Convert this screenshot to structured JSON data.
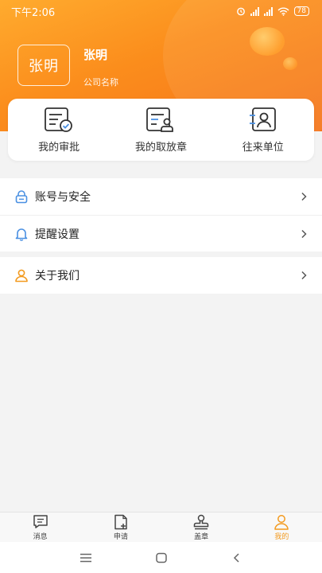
{
  "status_bar": {
    "time": "下午2:06",
    "battery": "78"
  },
  "profile": {
    "avatar_text": "张明",
    "name": "张明",
    "company": "公司名称"
  },
  "quick_actions": [
    {
      "label": "我的审批",
      "icon": "approval-icon"
    },
    {
      "label": "我的取放章",
      "icon": "seal-pickup-icon"
    },
    {
      "label": "往来单位",
      "icon": "contacts-icon"
    }
  ],
  "menu": {
    "account_security": "账号与安全",
    "reminder_settings": "提醒设置",
    "about_us": "关于我们"
  },
  "tabs": [
    {
      "label": "消息",
      "icon": "message-icon"
    },
    {
      "label": "申请",
      "icon": "apply-icon"
    },
    {
      "label": "盖章",
      "icon": "stamp-icon"
    },
    {
      "label": "我的",
      "icon": "profile-icon",
      "active": true
    }
  ],
  "colors": {
    "accent": "#f5861e",
    "tab_active": "#f39a1e"
  }
}
